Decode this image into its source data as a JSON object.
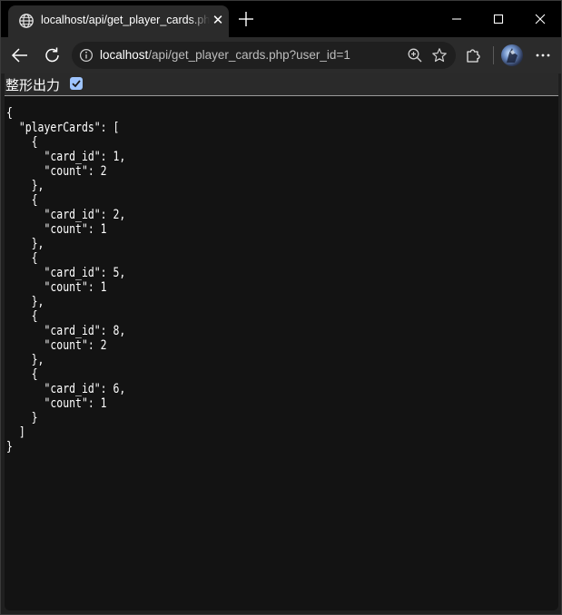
{
  "browser": {
    "tab_title": "localhost/api/get_player_cards.php?user_id=1",
    "address": {
      "host": "localhost",
      "path": "/api/get_player_cards.php?user_id=1"
    },
    "icons": {
      "tab": "globe-icon",
      "close": "close-icon",
      "new_tab": "plus-icon",
      "back": "back-arrow-icon",
      "reload": "reload-icon",
      "site_info": "info-icon",
      "zoom": "zoom-icon",
      "favorite": "star-icon",
      "extensions": "puzzle-icon",
      "profile": "avatar",
      "menu": "more-icon"
    }
  },
  "page": {
    "pretty_print_label": "整形出力",
    "pretty_print_checked": true,
    "json_lines": [
      "{",
      "  \"playerCards\": [",
      "    {",
      "      \"card_id\": 1,",
      "      \"count\": 2",
      "    },",
      "    {",
      "      \"card_id\": 2,",
      "      \"count\": 1",
      "    },",
      "    {",
      "      \"card_id\": 5,",
      "      \"count\": 1",
      "    },",
      "    {",
      "      \"card_id\": 8,",
      "      \"count\": 2",
      "    },",
      "    {",
      "      \"card_id\": 6,",
      "      \"count\": 1",
      "    }",
      "  ]",
      "}"
    ]
  }
}
